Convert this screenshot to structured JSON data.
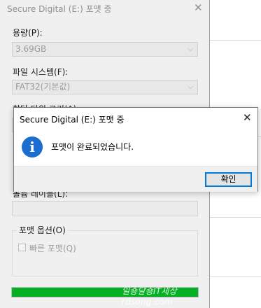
{
  "format_dialog": {
    "title": "Secure Digital (E:) 포맷 중",
    "capacity_label": "용량(P):",
    "capacity_value": "3.69GB",
    "filesystem_label": "파일 시스템(F):",
    "filesystem_value": "FAT32(기본값)",
    "allocation_label_partial": "할당 단위 크기(A):",
    "volume_label_partial": "볼륨 레이블(L):",
    "format_options_label": "포맷 옵션(O)",
    "quick_format_label": "빠른 포맷(Q)",
    "quick_format_checked": false,
    "progress_fraction": 1.0,
    "progress_color": "#06b025"
  },
  "message_box": {
    "title": "Secure Digital (E:) 포맷 중",
    "icon": "info-icon",
    "message": "포맷이 완료되었습니다.",
    "ok_label": "확인",
    "accent_color": "#0078d7"
  },
  "watermark": "일숑달숑IT세상 rdsong.com"
}
